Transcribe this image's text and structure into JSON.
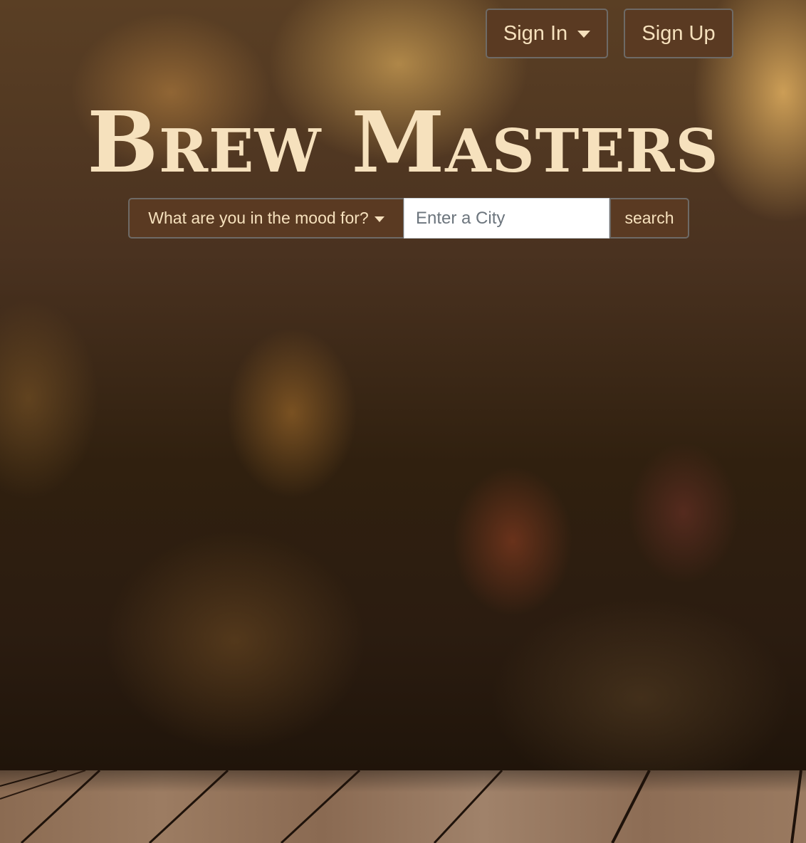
{
  "nav": {
    "sign_in_label": "Sign In",
    "sign_up_label": "Sign Up"
  },
  "hero": {
    "title": "Brew Masters"
  },
  "search": {
    "mood_label": "What are you in the mood for?",
    "city_placeholder": "Enter a City",
    "city_value": "",
    "button_label": "search"
  },
  "colors": {
    "button_bg": "#5a3a22",
    "text_cream": "#f6e1bd"
  }
}
